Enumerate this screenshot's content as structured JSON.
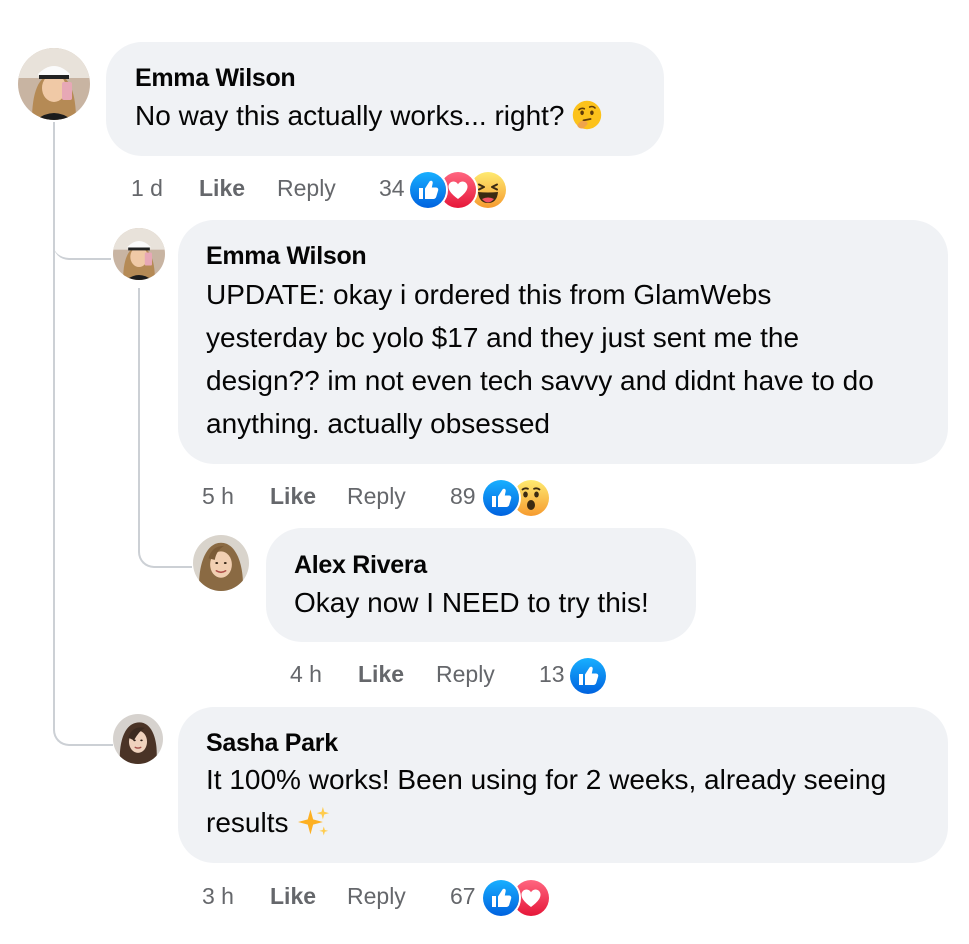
{
  "colors": {
    "bubble": "#f0f2f5",
    "thread_line": "#ccd0d5",
    "meta_text": "#65676b",
    "like_blue": "#1877f2",
    "love_red": "#f33e58",
    "haha_yellow": "#f7b125"
  },
  "comments": [
    {
      "author": "Emma Wilson",
      "text": "No way this actually works... right?",
      "inline_emoji": "thinking-face-emoji",
      "time": "1 d",
      "like_label": "Like",
      "reply_label": "Reply",
      "reaction_count": "34",
      "reactions": [
        "like-reaction-icon",
        "love-reaction-icon",
        "haha-reaction-icon"
      ]
    },
    {
      "author": "Emma Wilson",
      "text_lines": [
        "UPDATE: okay i ordered this from GlamWebs",
        "yesterday bc yolo $17 and they just sent me the",
        "design?? im not even tech savvy and didnt have to do",
        "anything. actually obsessed"
      ],
      "time": "5 h",
      "like_label": "Like",
      "reply_label": "Reply",
      "reaction_count": "89",
      "reactions": [
        "like-reaction-icon",
        "wow-reaction-icon"
      ]
    },
    {
      "author": "Alex Rivera",
      "text": "Okay now I NEED to try this!",
      "time": "4 h",
      "like_label": "Like",
      "reply_label": "Reply",
      "reaction_count": "13",
      "reactions": [
        "like-reaction-icon"
      ]
    },
    {
      "author": "Sasha Park",
      "text_lines": [
        "It 100% works! Been using for 2 weeks, already seeing",
        "results"
      ],
      "inline_emoji": "sparkles-emoji",
      "time": "3 h",
      "like_label": "Like",
      "reply_label": "Reply",
      "reaction_count": "67",
      "reactions": [
        "like-reaction-icon",
        "love-reaction-icon"
      ]
    }
  ]
}
